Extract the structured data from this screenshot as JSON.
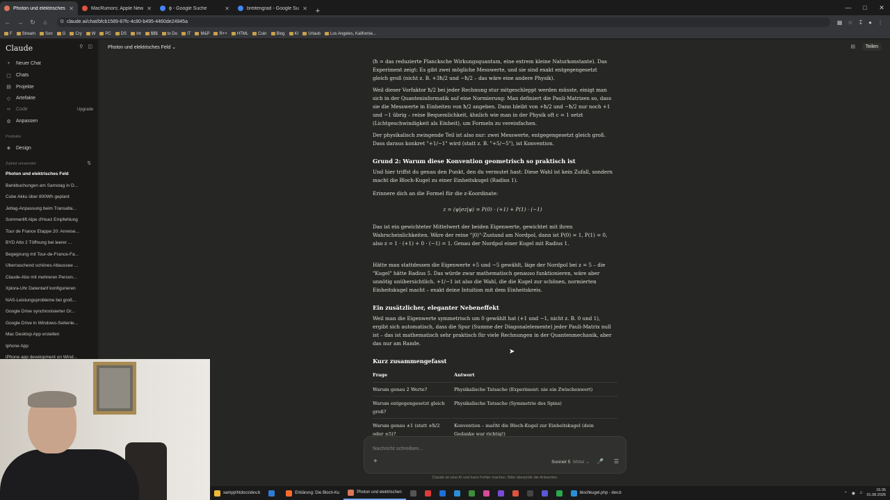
{
  "browser": {
    "tabs": [
      {
        "title": "Photon und elektrisches Feld",
        "color": "#d97757",
        "active": true
      },
      {
        "title": "MacRumors: Apple News and R...",
        "color": "#e0533c",
        "active": false
      },
      {
        "title": "ϕ - Google Suche",
        "color": "#4285f4",
        "active": false
      },
      {
        "title": "breitengrad - Google Suche",
        "color": "#4285f4",
        "active": false
      }
    ],
    "url": "claude.ai/chat/bfcb1589-87fc-4c80-b495-4460de24945a",
    "bookmarks": [
      "F",
      "Stream",
      "Son",
      "G",
      "Cry",
      "W",
      "PC",
      "DS",
      "Int",
      "$$$",
      "to Do",
      "IT",
      "M&P",
      "R++",
      "HTML",
      "Coin",
      "Blog",
      "KI",
      "Urlaub",
      "Los Angeles, Kalifornie..."
    ]
  },
  "sidebar": {
    "brand": "Claude",
    "nav": [
      {
        "label": "Neuer Chat",
        "icon": "plus"
      },
      {
        "label": "Chats",
        "icon": "chat"
      },
      {
        "label": "Projekte",
        "icon": "folder"
      },
      {
        "label": "Artefakte",
        "icon": "artifact"
      },
      {
        "label": "Code",
        "icon": "code"
      },
      {
        "label": "Anpassen",
        "icon": "customize"
      }
    ],
    "upgrade": "Upgrade",
    "products_label": "Produkte",
    "design": "Design",
    "recent_label": "Zuletzt verwendet",
    "recent": [
      "Photon und elektrisches Feld",
      "Bankbuchungen am Samstag in D...",
      "Cube Akku über 800Wh geplant",
      "Jetlag-Anpassung beim Transatla...",
      "Sommerlift Alpe d'Huez Empfehlung",
      "Tour de France Etappe 20: Anreise...",
      "BYD Atto 2 Töffnung bei leerer ...",
      "Begegnung mit Tour-de-France-Fa...",
      "Überraschend schönes Altaussee ...",
      "Claude-Abo mit mehreren Person...",
      "Xplora-Uhr Datentarif konfigurieren",
      "NAS-Leistungsprobleme bei groß...",
      "Google Drive synchronisierter Or...",
      "Google Drive in Windows-Seitenle...",
      "Mac Desktop App erstellen",
      "Iphone App",
      "iPhone app development on Wind..."
    ]
  },
  "header": {
    "title": "Photon und elektrisches Feld",
    "share": "Teilen"
  },
  "content": {
    "p1": "(ħ = das reduzierte Plancksche Wirkungsquantum, eine extrem kleine Naturkonstante). Das Experiment zeigt: Es gibt zwei mögliche Messwerte, und sie sind exakt entgegengesetzt gleich groß (nicht z. B. +3ħ/2 und −ħ/2 – das wäre eine andere Physik).",
    "p2": "Weil dieser Vorfaktor ħ/2 bei jeder Rechnung stur mitgeschleppt werden müsste, einigt man sich in der Quanteninformatik auf eine Normierung: Man definiert die Pauli-Matrizen so, dass sie die Messwerte in Einheiten von ħ/2 angeben. Dann bleibt von +ħ/2 und −ħ/2 nur noch +1 und −1 übrig – reine Bequemlichkeit, ähnlich wie man in der Physik oft c = 1 setzt (Lichtgeschwindigkeit als Einheit), um Formeln zu vereinfachen.",
    "p3": "Der physikalisch zwingende Teil ist also nur: zwei Messwerte, entgegengesetzt gleich groß. Dass daraus konkret \"+1/−1\" wird (statt z. B. \"+5/−5\"), ist Konvention.",
    "h1": "Grund 2: Warum diese Konvention geometrisch so praktisch ist",
    "p4": "Und hier triffst du genau den Punkt, den du vermutet hast: Diese Wahl ist kein Zufall, sondern macht die Bloch-Kugel zu einer Einheitskugel (Radius 1).",
    "p5": "Erinnere dich an die Formel für die z-Koordinate:",
    "formula": "z = ⟨ψ|σz|ψ⟩ = P(0) · (+1) + P(1) · (−1)",
    "p6": "Das ist ein gewichteter Mittelwert der beiden Eigenwerte, gewichtet mit ihren Wahrscheinlichkeiten. Wäre der reine \"|0⟩\"-Zustand am Nordpol, dann ist P(0) = 1, P(1) = 0, also z = 1 · (+1) + 0 · (−1) = 1. Genau der Nordpol einer Kugel mit Radius 1.",
    "p7": "Hätte man stattdessen die Eigenwerte +5 und −5 gewählt, läge der Nordpol bei z = 5 – die \"Kugel\" hätte Radius 5. Das würde zwar mathematisch genauso funktionieren, wäre aber unnötig unübersichtlich. +1/−1 ist also die Wahl, die die Kugel zur schönen, normierten Einheitskugel macht – exakt deine Intuition mit dem Einheitskreis.",
    "h2": "Ein zusätzlicher, eleganter Nebeneffekt",
    "p8": "Weil man die Eigenwerte symmetrisch um 0 gewählt hat (+1 und −1, nicht z. B. 0 und 1), ergibt sich automatisch, dass die Spur (Summe der Diagonalelemente) jeder Pauli-Matrix null ist – das ist mathematisch sehr praktisch für viele Rechnungen in der Quantenmechanik, aber das nur am Rande.",
    "h3": "Kurz zusammengefasst",
    "table": {
      "headers": [
        "Frage",
        "Antwort"
      ],
      "rows": [
        [
          "Warum genau 2 Werte?",
          "Physikalische Tatsache (Experiment: nie ein Zwischenwert)"
        ],
        [
          "Warum entgegengesetzt gleich groß?",
          "Physikalische Tatsache (Symmetrie des Spins)"
        ],
        [
          "Warum genau ±1 (statt ±ħ/2 oder ±5)?",
          "Konvention – macht die Bloch-Kugel zur Einheitskugel (dein Gedanke war richtig!)"
        ]
      ]
    }
  },
  "composer": {
    "placeholder": "Nachricht schreiben...",
    "model": "Sonnet 5",
    "mode": "Mittel",
    "disclaimer": "Claude ist eine KI und kann Fehler machen. Bitte überprüfe die Antworten."
  },
  "taskbar": {
    "items": [
      {
        "label": "xampp\\htdocs\\dev.b",
        "color": "#f0b93a"
      },
      {
        "label": "",
        "color": "#2f7bd6"
      },
      {
        "label": "Erklärung: Die Bloch-Ku",
        "color": "#ff6b2c"
      },
      {
        "label": "Photon und elektrischen",
        "color": "#d97757"
      },
      {
        "label": "blochkugel.php - dev.b",
        "color": "#2a8fd6"
      }
    ],
    "time": "15:35",
    "date": "01.08.2026"
  }
}
